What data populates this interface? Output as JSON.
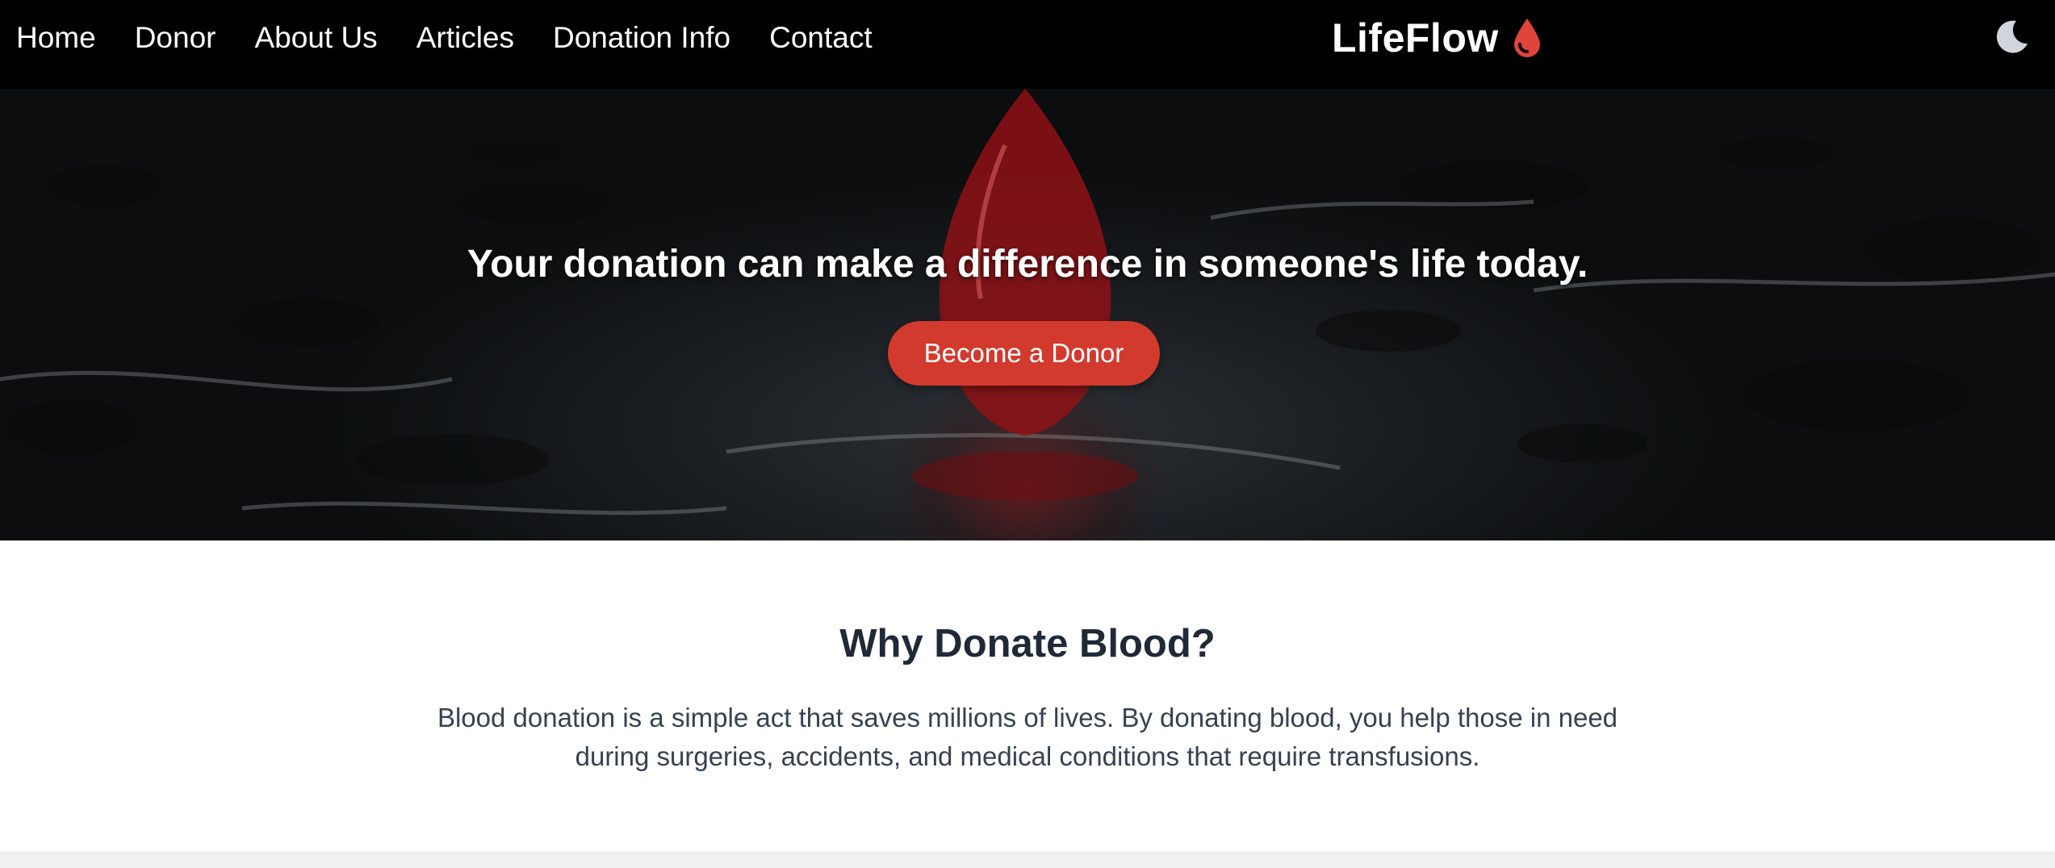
{
  "nav": {
    "links": [
      "Home",
      "Donor",
      "About Us",
      "Articles",
      "Donation Info",
      "Contact"
    ],
    "brand": "LifeFlow",
    "brand_icon": "blood-drop-icon",
    "theme_icon": "moon-icon"
  },
  "hero": {
    "headline": "Your donation can make a difference in someone's life today.",
    "cta_label": "Become a Donor"
  },
  "why": {
    "title": "Why Donate Blood?",
    "body": "Blood donation is a simple act that saves millions of lives. By donating blood, you help those in need during surgeries, accidents, and medical conditions that require transfusions."
  },
  "colors": {
    "navbar_bg": "#000000",
    "accent_red": "#d23a2e",
    "drop_red": "#e0453b",
    "heading_text": "#1f2937",
    "body_text": "#374151"
  }
}
